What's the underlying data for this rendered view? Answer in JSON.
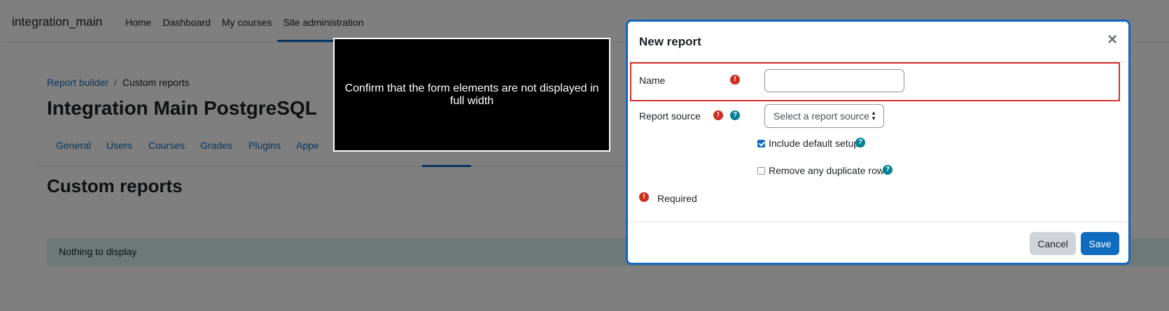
{
  "site": {
    "brand": "integration_main",
    "nav": [
      "Home",
      "Dashboard",
      "My courses",
      "Site administration"
    ]
  },
  "breadcrumb": {
    "items": [
      "Report builder",
      "Custom reports"
    ],
    "separator": "/"
  },
  "page": {
    "title": "Integration Main PostgreSQL",
    "secondary_nav": [
      "General",
      "Users",
      "Courses",
      "Grades",
      "Plugins",
      "Appe"
    ],
    "section_title": "Custom reports",
    "empty_message": "Nothing to display"
  },
  "tooltip": {
    "text": "Confirm that the form elements are not displayed in full width"
  },
  "modal": {
    "title": "New report",
    "close_symbol": "×",
    "name_label": "Name",
    "name_value": "",
    "report_source_label": "Report source",
    "report_source_placeholder": "Select a report source",
    "include_default_setup_label": "Include default setup",
    "include_default_setup_checked": true,
    "remove_duplicates_label": "Remove any duplicate rows",
    "remove_duplicates_checked": false,
    "required_label": "Required",
    "cancel_label": "Cancel",
    "save_label": "Save"
  },
  "icons": {
    "required": "exclamation-circle-icon",
    "help": "question-circle-icon",
    "close": "close-icon"
  },
  "colors": {
    "primary": "#0f6cbf",
    "required": "#ca3120",
    "help": "#008196",
    "highlight": "#d32f2f",
    "alert_bg": "#d8f2ef"
  }
}
